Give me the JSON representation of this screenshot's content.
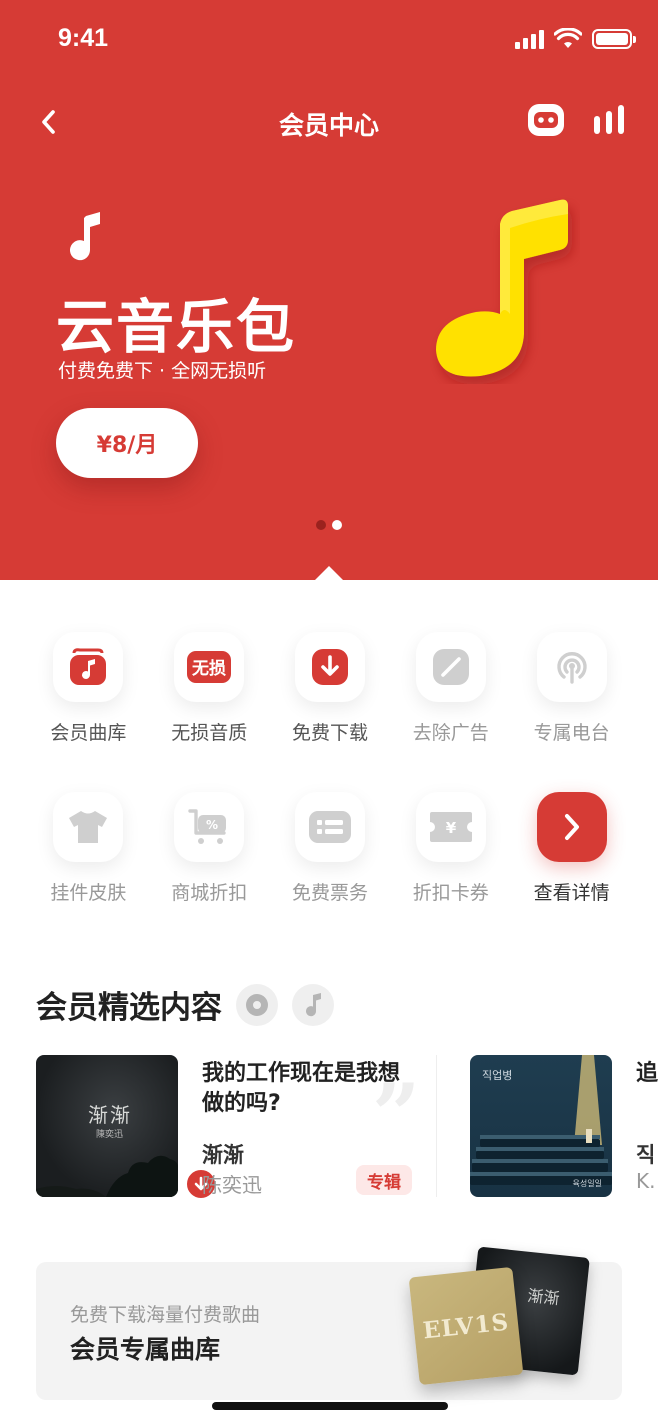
{
  "status_bar": {
    "time": "9:41"
  },
  "header": {
    "title": "会员中心"
  },
  "banner": {
    "title": "云音乐包",
    "subtitle": "付费免费下 · 全网无损听",
    "price_label": "¥8/月",
    "page_count": 2,
    "active_page": 1
  },
  "features": {
    "row1": [
      {
        "label": "会员曲库",
        "icon": "music-library-icon"
      },
      {
        "label": "无损音质",
        "icon": "lossless-badge-icon",
        "badge_text": "无损"
      },
      {
        "label": "免费下载",
        "icon": "download-icon"
      },
      {
        "label": "去除广告",
        "icon": "no-ads-icon"
      },
      {
        "label": "专属电台",
        "icon": "radio-icon"
      }
    ],
    "row2": [
      {
        "label": "挂件皮肤",
        "icon": "tshirt-icon"
      },
      {
        "label": "商城折扣",
        "icon": "cart-discount-icon"
      },
      {
        "label": "免费票务",
        "icon": "ticket-list-icon"
      },
      {
        "label": "折扣卡券",
        "icon": "coupon-icon"
      },
      {
        "label": "查看详情",
        "icon": "chevron-right-icon"
      }
    ]
  },
  "section": {
    "title": "会员精选内容",
    "cards": [
      {
        "title": "我的工作现在是我想做的吗?",
        "song": "渐渐",
        "artist": "陈奕迅",
        "tag": "专辑",
        "cover_text": "渐渐",
        "cover_sub": "陳奕迅"
      },
      {
        "title": "追",
        "song": "직",
        "artist": "K.",
        "cover_label": "직업병",
        "cover_foot": "육성일일"
      }
    ]
  },
  "promo": {
    "subtitle": "免费下载海量付费歌曲",
    "title": "会员专属曲库",
    "album_front_text": "ELV1S",
    "album_back_text": "渐渐"
  },
  "colors": {
    "brand_red": "#D63B35",
    "note_yellow": "#FFE100"
  }
}
